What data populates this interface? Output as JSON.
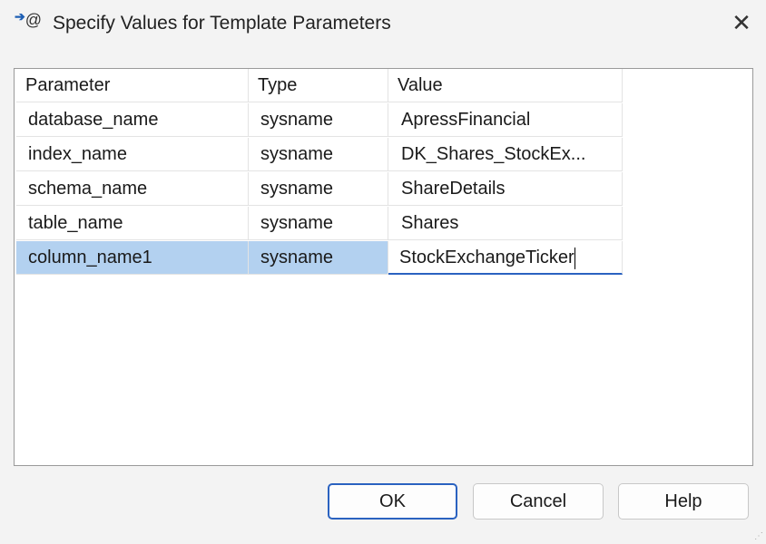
{
  "dialog": {
    "title": "Specify Values for Template Parameters",
    "icon": "template-parameter-icon"
  },
  "columns": [
    "Parameter",
    "Type",
    "Value"
  ],
  "rows": [
    {
      "parameter": "database_name",
      "type": "sysname",
      "value": "ApressFinancial"
    },
    {
      "parameter": "index_name",
      "type": "sysname",
      "value": "DK_Shares_StockEx..."
    },
    {
      "parameter": "schema_name",
      "type": "sysname",
      "value": "ShareDetails"
    },
    {
      "parameter": "table_name",
      "type": "sysname",
      "value": "Shares"
    },
    {
      "parameter": "column_name1",
      "type": "sysname",
      "value": "StockExchangeTicker"
    }
  ],
  "buttons": {
    "ok": "OK",
    "cancel": "Cancel",
    "help": "Help"
  },
  "close_symbol": "✕"
}
